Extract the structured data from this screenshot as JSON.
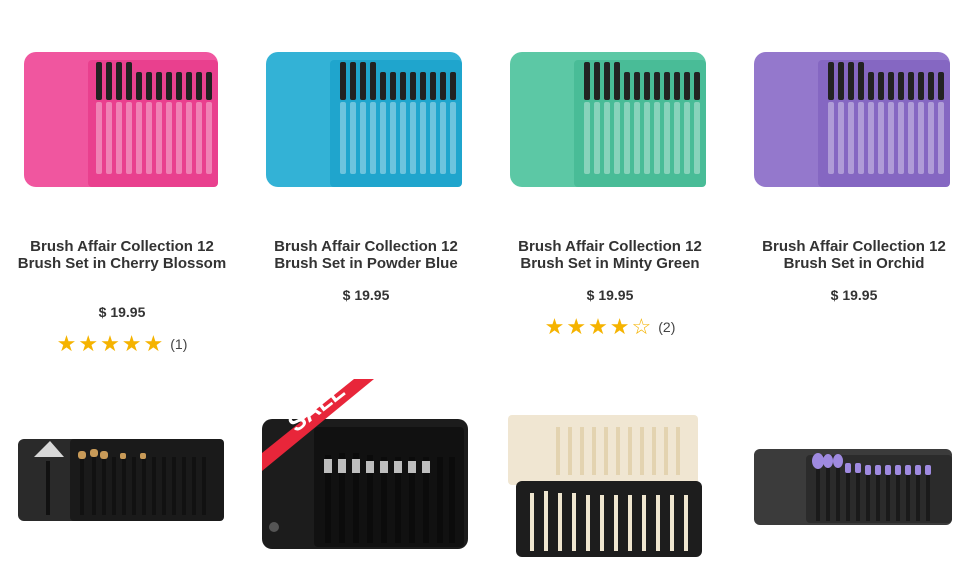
{
  "products_row1": [
    {
      "name": "Brush Affair Collection 12 Brush Set in Cherry Blossom",
      "price": "$ 19.95",
      "stars": 5,
      "reviews": "(1)",
      "color": "#f0569f"
    },
    {
      "name": "Brush Affair Collection 12 Brush Set in Powder Blue",
      "price": "$ 19.95",
      "stars": 0,
      "reviews": "",
      "color": "#33b2d6"
    },
    {
      "name": "Brush Affair Collection 12 Brush Set in Minty Green",
      "price": "$ 19.95",
      "stars": 4,
      "reviews": "(2)",
      "color": "#5cc8a5"
    },
    {
      "name": "Brush Affair Collection 12 Brush Set in Orchid",
      "price": "$ 19.95",
      "stars": 0,
      "reviews": "",
      "color": "#9478cc"
    }
  ],
  "products_row2": [
    {
      "variant": "black-fan-set",
      "badge": ""
    },
    {
      "variant": "black-pro-set",
      "badge": "SALE"
    },
    {
      "variant": "bamboo-dual-set",
      "badge": ""
    },
    {
      "variant": "lilac-black-set",
      "badge": ""
    }
  ],
  "icons": {
    "star": "star-icon",
    "star_empty": "star-outline-icon"
  },
  "colors": {
    "star": "#f5b300",
    "sale_ribbon": "#e8263a",
    "text": "#333333"
  }
}
